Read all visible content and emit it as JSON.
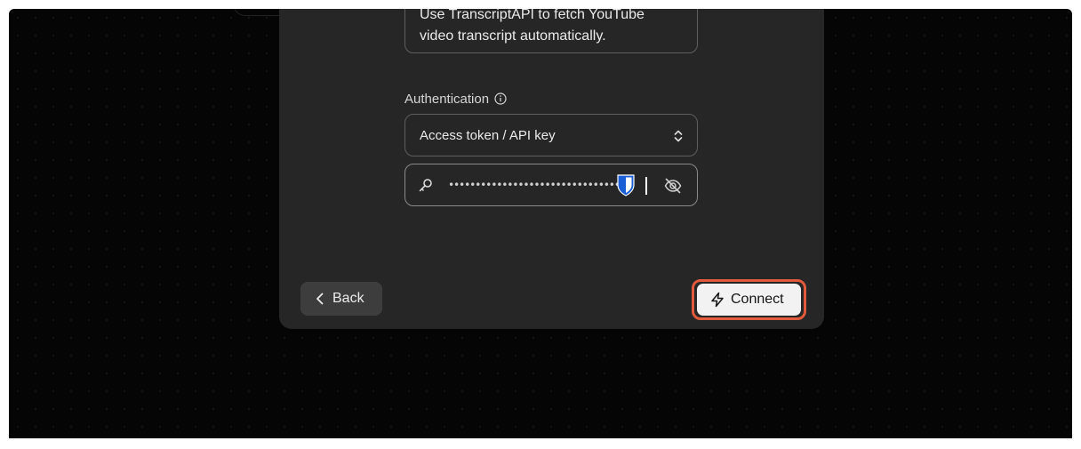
{
  "form": {
    "description": [
      "Use TranscriptAPI to fetch YouTube",
      "video transcript automatically."
    ],
    "authentication_label": "Authentication",
    "auth_method_selected": "Access token / API key",
    "api_key_masked": "••••••••••••••••••••••••••••••••••••••••••"
  },
  "footer": {
    "back_label": "Back",
    "connect_label": "Connect"
  },
  "colors": {
    "backdrop": "#050505",
    "modal": "#262626",
    "connect_highlight": "#e05a3b",
    "password_manager": "#1b5fd6"
  },
  "icons": [
    "info-icon",
    "chevron-up-down-icon",
    "key-icon",
    "password-manager-icon",
    "eye-off-icon",
    "chevron-left-icon",
    "lightning-icon"
  ]
}
